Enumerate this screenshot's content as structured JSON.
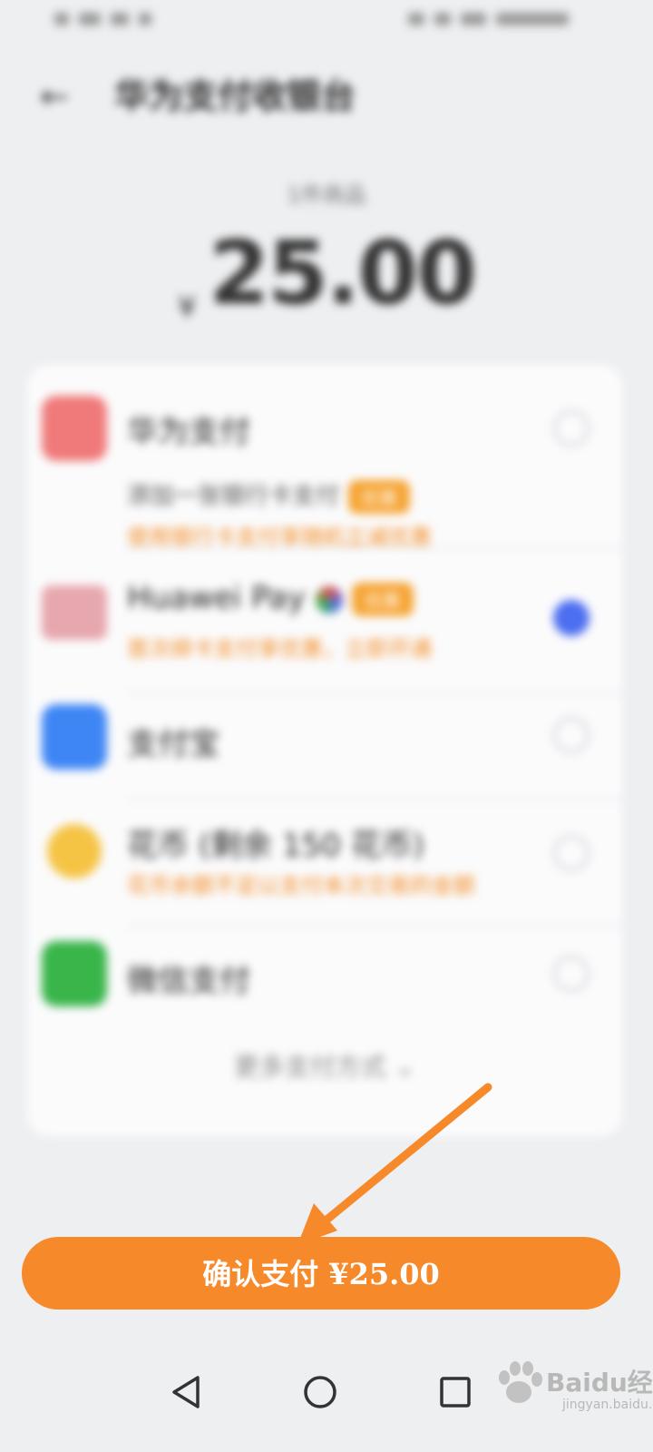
{
  "status_bar": {
    "left_text": "",
    "right_text": ""
  },
  "header": {
    "title": "华为支付收银台"
  },
  "amount": {
    "label": "1件商品",
    "currency": "¥",
    "value": "25.00"
  },
  "payment_methods": [
    {
      "name": "华为支付",
      "desc": "添加一张银行卡支付",
      "badge": "优惠",
      "sub": "使用银行卡支付享随机立减优惠",
      "color": "#f07a7a",
      "checked": false
    },
    {
      "name": "Huawei Pay",
      "badge": "优惠",
      "sub": "首次绑卡支付享优惠，立即开通",
      "color": "#e7a7ae",
      "checked": true
    },
    {
      "name": "支付宝",
      "color": "#3f86f5",
      "checked": false
    },
    {
      "name": "花币 (剩余 150 花币)",
      "sub": "花币余额不足以支付本次交易的金额",
      "color": "#f6c445",
      "checked": false
    },
    {
      "name": "微信支付",
      "color": "#39b54a",
      "checked": false
    }
  ],
  "more_methods_label": "更多支付方式 ⌄",
  "confirm_button": {
    "label": "确认支付 ¥25.00"
  },
  "watermark": {
    "brand": "Baidu经验",
    "url": "jingyan.baidu.com"
  },
  "nav": {
    "back": "back-icon",
    "home": "home-icon",
    "recents": "recents-icon"
  }
}
